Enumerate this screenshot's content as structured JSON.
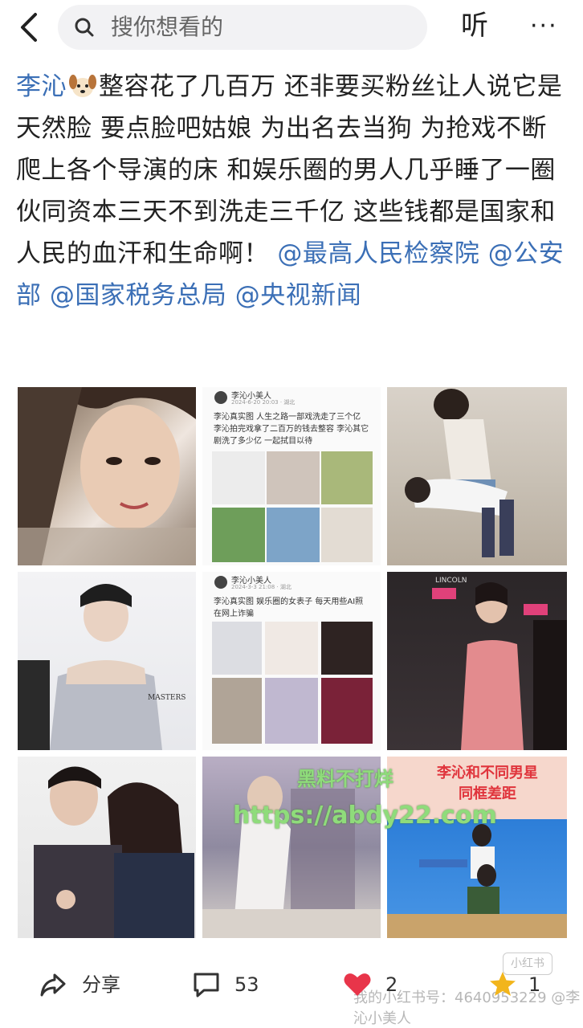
{
  "search": {
    "placeholder": "搜你想看的"
  },
  "header": {
    "listen_label": "听",
    "more_label": "···"
  },
  "post": {
    "author": "李沁",
    "body": "整容花了几百万 还非要买粉丝让人说它是天然脸 要点脸吧姑娘 为出名去当狗 为抢戏不断爬上各个导演的床 和娱乐圈的男人几乎睡了一圈 伙同资本三天不到洗走三千亿 这些钱都是国家和人民的血汗和生命啊！",
    "mentions": [
      "@最高人民检察院",
      "@公安部",
      "@国家税务总局",
      "@央视新闻"
    ]
  },
  "images": {
    "screenshot1": {
      "user": "李沁小美人",
      "date": "2024-6-20 20:03 · 湖北",
      "text": "李沁真实图 人生之路一部戏洗走了三个亿 李沁拍完戏拿了二百万的钱去整容 李沁其它剧洗了多少亿 一起拭目以待"
    },
    "screenshot2": {
      "user": "李沁小美人",
      "date": "2024-3-3 21:08 · 湖北",
      "text": "李沁真实图 娱乐圈的女表子 每天用些AI照在网上诈骗"
    },
    "backdrop_text": "MASTERS",
    "event_text": "LINCOLN",
    "banner": {
      "line1": "李沁和不同男星",
      "line2": "同框差距"
    }
  },
  "watermark": {
    "line1": "黑料不打烊",
    "line2": "https://abdy22.com",
    "line3": "我的小红书号：4640953229 @李沁小美人",
    "logo": "小红书"
  },
  "actions": {
    "share": "分享",
    "comments": "53",
    "likes": "2",
    "favorites": "1"
  },
  "colors": {
    "link": "#3b6fb6",
    "like": "#e8354a",
    "favorite": "#f2b51c"
  }
}
